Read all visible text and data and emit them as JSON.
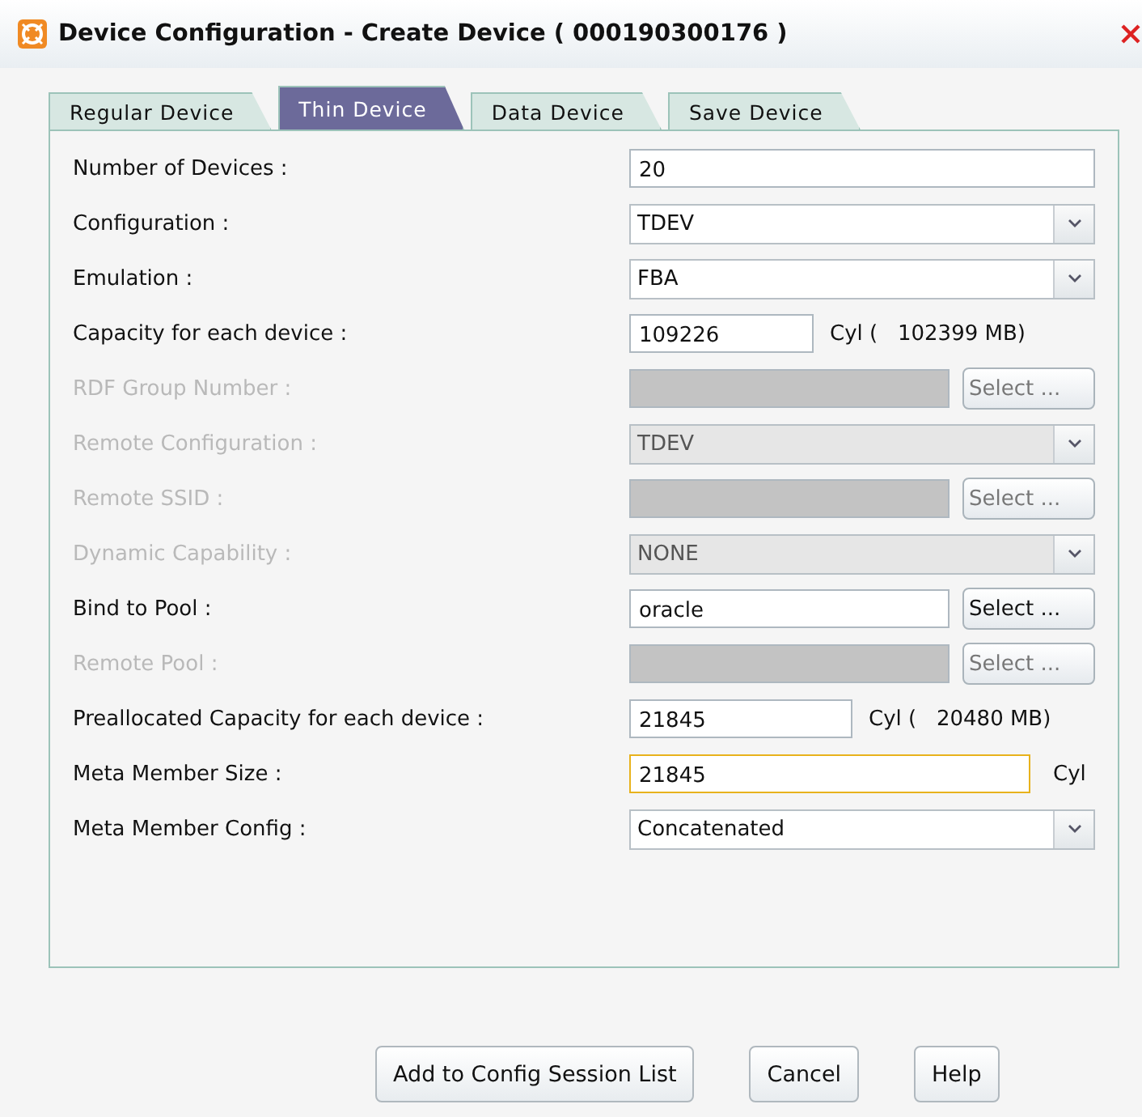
{
  "window": {
    "title": "Device Configuration - Create Device ( 000190300176 )"
  },
  "tabs": [
    {
      "label": "Regular Device",
      "selected": false
    },
    {
      "label": "Thin Device",
      "selected": true
    },
    {
      "label": "Data Device",
      "selected": false
    },
    {
      "label": "Save Device",
      "selected": false
    }
  ],
  "rows": [
    {
      "kind": "text",
      "label": "Number of Devices :",
      "disabled": false,
      "value": "20"
    },
    {
      "kind": "select",
      "label": "Configuration :",
      "disabled": false,
      "value": "TDEV"
    },
    {
      "kind": "select",
      "label": "Emulation :",
      "disabled": false,
      "value": "FBA"
    },
    {
      "kind": "unit",
      "label": "Capacity for each device :",
      "disabled": false,
      "value": "109226",
      "unit": "Cyl (   102399 MB)",
      "focused": false
    },
    {
      "kind": "picker",
      "label": "RDF Group Number :",
      "disabled": true,
      "button": "Select ..."
    },
    {
      "kind": "select",
      "label": "Remote Configuration :",
      "disabled": true,
      "value": "TDEV"
    },
    {
      "kind": "picker",
      "label": "Remote SSID :",
      "disabled": true,
      "button": "Select ..."
    },
    {
      "kind": "select",
      "label": "Dynamic Capability :",
      "disabled": true,
      "value": "NONE"
    },
    {
      "kind": "picker",
      "label": "Bind to Pool :",
      "disabled": false,
      "value": "oracle",
      "button": "Select ..."
    },
    {
      "kind": "picker",
      "label": "Remote Pool :",
      "disabled": true,
      "button": "Select ..."
    },
    {
      "kind": "unit",
      "label": "Preallocated Capacity for each device :",
      "disabled": false,
      "value": "21845",
      "unit": "Cyl (   20480 MB)",
      "focused": false
    },
    {
      "kind": "wideunit",
      "label": "Meta Member Size :",
      "disabled": false,
      "value": "21845",
      "unit": "Cyl",
      "focused": true
    },
    {
      "kind": "select",
      "label": "Meta Member Config :",
      "disabled": false,
      "value": "Concatenated"
    }
  ],
  "buttons": [
    "Add to Config Session List",
    "Cancel",
    "Help"
  ]
}
